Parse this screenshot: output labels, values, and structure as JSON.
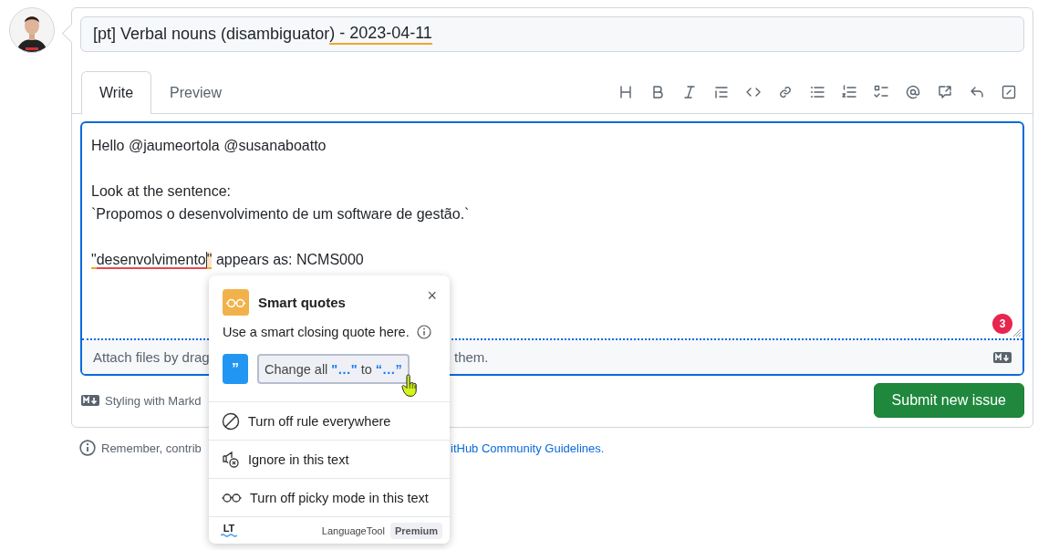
{
  "issue_title": {
    "segments": [
      {
        "text": "[pt] Verbal nouns (disambiguator",
        "kind": "plain"
      },
      {
        "text": ") - 2023-04-11",
        "kind": "warning"
      }
    ]
  },
  "tabs": [
    {
      "label": "Write",
      "selected": true
    },
    {
      "label": "Preview",
      "selected": false
    }
  ],
  "editor": {
    "paragraphs": [
      {
        "lines": [
          {
            "segments": [
              {
                "text": "Hello @jaumeortola @susanaboatto",
                "kind": "plain"
              }
            ]
          }
        ]
      },
      {
        "lines": [
          {
            "segments": [
              {
                "text": "Look at the sentence:",
                "kind": "plain"
              }
            ]
          },
          {
            "segments": [
              {
                "text": "`Propomos o desenvolvimento de um software de gestão.`",
                "kind": "plain"
              }
            ]
          }
        ]
      },
      {
        "lines": [
          {
            "segments": [
              {
                "text": "\"",
                "kind": "warning"
              },
              {
                "text": "desenvolvimento",
                "kind": "error"
              },
              {
                "text": "\"",
                "kind": "focus"
              },
              {
                "text": " appears as: NCMS000",
                "kind": "plain"
              }
            ]
          }
        ]
      }
    ],
    "issue_count": "3",
    "attach_left": "Attach files by drag",
    "attach_right": "them."
  },
  "styling_hint": "Styling with Markd",
  "submit_button": "Submit new issue",
  "remember_left": "Remember, contrib",
  "remember_link": "itHub Community Guidelines.",
  "popup": {
    "title": "Smart quotes",
    "close": "×",
    "description": "Use a smart closing quote here.",
    "suggestion_mark": "”",
    "suggestion": [
      {
        "text": "Change all ",
        "kind": "plain"
      },
      {
        "text": "\"…\"",
        "kind": "quote"
      },
      {
        "text": " to ",
        "kind": "plain"
      },
      {
        "text": "“…”",
        "kind": "quote"
      }
    ],
    "actions": [
      {
        "label": "Turn off rule everywhere",
        "kind": "disable"
      },
      {
        "label": "Ignore in this text",
        "kind": "ignore"
      },
      {
        "label": "Turn off picky mode in this text",
        "kind": "picky"
      }
    ],
    "logo": "LT",
    "brand": "LanguageTool",
    "plan": "Premium"
  }
}
